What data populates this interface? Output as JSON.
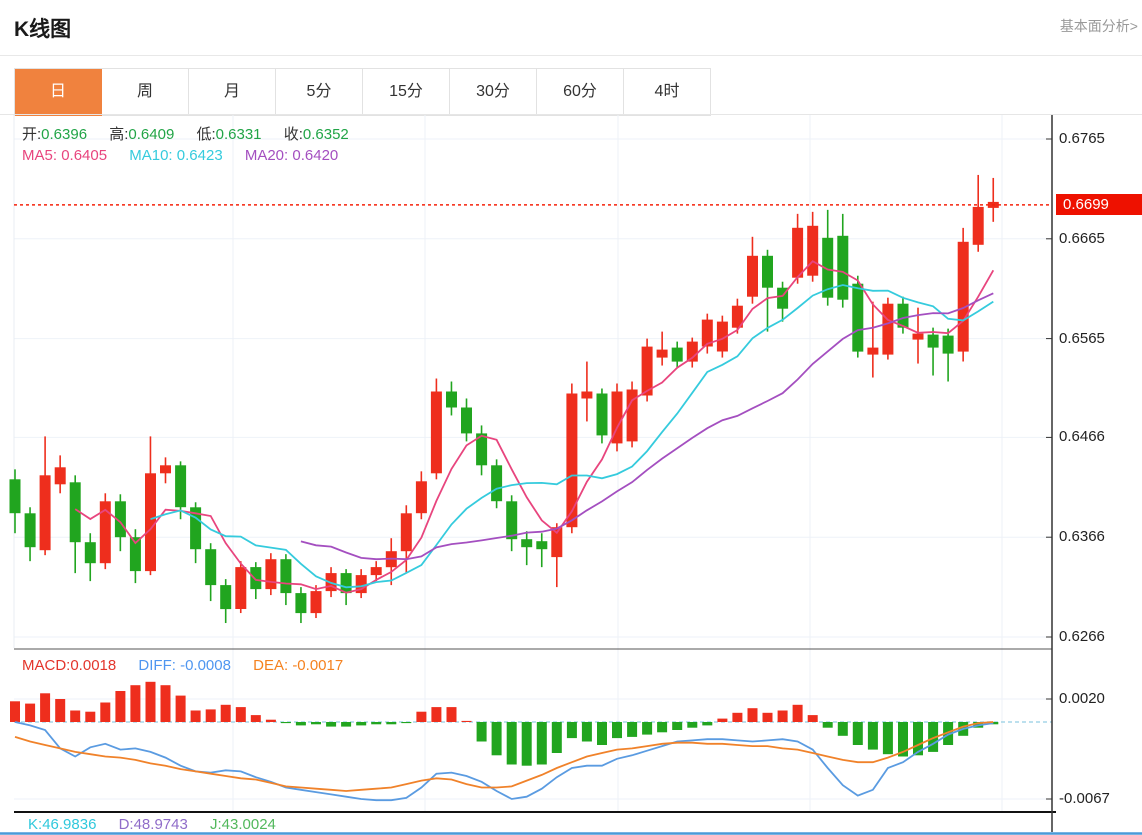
{
  "header": {
    "title": "K线图",
    "fundamental_link": "基本面分析>"
  },
  "tabs": {
    "items": [
      "日",
      "周",
      "月",
      "5分",
      "15分",
      "30分",
      "60分",
      "4时"
    ],
    "active_index": 0,
    "active_color": "#f0823e"
  },
  "legend_ohlc": {
    "value_color": "#21a447",
    "items": [
      {
        "label": "开:",
        "value": "0.6396"
      },
      {
        "label": "高:",
        "value": "0.6409"
      },
      {
        "label": "低:",
        "value": "0.6331"
      },
      {
        "label": "收:",
        "value": "0.6352"
      }
    ]
  },
  "legend_ma": {
    "items": [
      {
        "label": "MA5:",
        "value": "0.6405",
        "color": "#e8457e"
      },
      {
        "label": "MA10:",
        "value": "0.6423",
        "color": "#35cbdd"
      },
      {
        "label": "MA20:",
        "value": "0.6420",
        "color": "#a44fc0"
      }
    ]
  },
  "legend_macd": {
    "items": [
      {
        "label": "MACD:",
        "value": "0.0018",
        "color": "#e3352c"
      },
      {
        "label": "DIFF:",
        "value": "-0.0008",
        "color": "#4f96f0"
      },
      {
        "label": "DEA:",
        "value": "-0.0017",
        "color": "#f5821f"
      }
    ]
  },
  "legend_kdj": {
    "items": [
      {
        "label": "K:",
        "value": "46.9836",
        "color": "#2fc8dc"
      },
      {
        "label": "D:",
        "value": "48.9743",
        "color": "#8f6cc9"
      },
      {
        "label": "J:",
        "value": "43.0024",
        "color": "#52b85c"
      }
    ]
  },
  "price_marker": {
    "value": "0.6699",
    "price": 0.6699,
    "color": "#ee1100"
  },
  "chart_data": [
    {
      "type": "candlestick",
      "title": "K线图 (日)",
      "up_color": "#ee2e1d",
      "down_color": "#21a51f",
      "grid": true,
      "legend_position": "top-left",
      "y_axis_labels": [
        "0.6765",
        "0.6665",
        "0.6565",
        "0.6466",
        "0.6366",
        "0.6266"
      ],
      "current_price": 0.6699,
      "moving_averages": {
        "ma5": 0.6405,
        "ma10": 0.6423,
        "ma20": 0.642
      },
      "ohlc": [
        [
          0.6424,
          0.6434,
          0.637,
          0.639
        ],
        [
          0.639,
          0.6396,
          0.6342,
          0.6356
        ],
        [
          0.6353,
          0.6467,
          0.6348,
          0.6428
        ],
        [
          0.6419,
          0.6448,
          0.641,
          0.6436
        ],
        [
          0.6421,
          0.6428,
          0.633,
          0.6361
        ],
        [
          0.6361,
          0.637,
          0.6322,
          0.634
        ],
        [
          0.634,
          0.641,
          0.6334,
          0.6402
        ],
        [
          0.6402,
          0.6409,
          0.6352,
          0.6366
        ],
        [
          0.6366,
          0.6374,
          0.632,
          0.6332
        ],
        [
          0.6332,
          0.6467,
          0.6328,
          0.643
        ],
        [
          0.643,
          0.6446,
          0.642,
          0.6438
        ],
        [
          0.6438,
          0.6442,
          0.6384,
          0.6396
        ],
        [
          0.6396,
          0.6401,
          0.634,
          0.6354
        ],
        [
          0.6354,
          0.636,
          0.6302,
          0.6318
        ],
        [
          0.6318,
          0.6324,
          0.628,
          0.6294
        ],
        [
          0.6294,
          0.6342,
          0.629,
          0.6336
        ],
        [
          0.6336,
          0.6341,
          0.6304,
          0.6314
        ],
        [
          0.6314,
          0.635,
          0.6308,
          0.6344
        ],
        [
          0.6344,
          0.6349,
          0.6298,
          0.631
        ],
        [
          0.631,
          0.6316,
          0.628,
          0.629
        ],
        [
          0.629,
          0.6318,
          0.6285,
          0.6312
        ],
        [
          0.6312,
          0.6336,
          0.6306,
          0.633
        ],
        [
          0.633,
          0.6334,
          0.6298,
          0.631
        ],
        [
          0.631,
          0.6334,
          0.6305,
          0.6328
        ],
        [
          0.6328,
          0.6342,
          0.6322,
          0.6336
        ],
        [
          0.6336,
          0.6365,
          0.6318,
          0.6352
        ],
        [
          0.6352,
          0.6398,
          0.633,
          0.639
        ],
        [
          0.639,
          0.6432,
          0.6384,
          0.6422
        ],
        [
          0.643,
          0.6525,
          0.6424,
          0.6512
        ],
        [
          0.6512,
          0.6522,
          0.6488,
          0.6496
        ],
        [
          0.6496,
          0.6505,
          0.6462,
          0.647
        ],
        [
          0.647,
          0.6478,
          0.6428,
          0.6438
        ],
        [
          0.6438,
          0.6444,
          0.6395,
          0.6402
        ],
        [
          0.6402,
          0.6408,
          0.6352,
          0.6364
        ],
        [
          0.6364,
          0.6372,
          0.6338,
          0.6356
        ],
        [
          0.6362,
          0.637,
          0.6336,
          0.6354
        ],
        [
          0.6346,
          0.638,
          0.6316,
          0.6376
        ],
        [
          0.6376,
          0.652,
          0.637,
          0.651
        ],
        [
          0.6505,
          0.6542,
          0.6482,
          0.6512
        ],
        [
          0.651,
          0.6515,
          0.646,
          0.6468
        ],
        [
          0.646,
          0.652,
          0.6452,
          0.6512
        ],
        [
          0.6462,
          0.6522,
          0.6456,
          0.6514
        ],
        [
          0.6508,
          0.6565,
          0.6502,
          0.6557
        ],
        [
          0.6546,
          0.6572,
          0.6538,
          0.6554
        ],
        [
          0.6556,
          0.6562,
          0.6536,
          0.6542
        ],
        [
          0.6542,
          0.6566,
          0.6536,
          0.6562
        ],
        [
          0.6557,
          0.659,
          0.655,
          0.6584
        ],
        [
          0.6552,
          0.6588,
          0.6546,
          0.6582
        ],
        [
          0.6576,
          0.6605,
          0.657,
          0.6598
        ],
        [
          0.6607,
          0.6667,
          0.66,
          0.6648
        ],
        [
          0.6648,
          0.6654,
          0.6572,
          0.6616
        ],
        [
          0.6616,
          0.6622,
          0.6582,
          0.6595
        ],
        [
          0.6626,
          0.669,
          0.662,
          0.6676
        ],
        [
          0.6628,
          0.6692,
          0.6622,
          0.6678
        ],
        [
          0.6666,
          0.6694,
          0.6598,
          0.6606
        ],
        [
          0.6668,
          0.669,
          0.6596,
          0.6604
        ],
        [
          0.662,
          0.6628,
          0.6546,
          0.6552
        ],
        [
          0.6549,
          0.6602,
          0.6526,
          0.6556
        ],
        [
          0.6549,
          0.6606,
          0.6544,
          0.66
        ],
        [
          0.66,
          0.6607,
          0.657,
          0.6576
        ],
        [
          0.6564,
          0.6596,
          0.654,
          0.657
        ],
        [
          0.6569,
          0.6576,
          0.6528,
          0.6556
        ],
        [
          0.6568,
          0.6575,
          0.6522,
          0.655
        ],
        [
          0.6552,
          0.6676,
          0.6542,
          0.6662
        ],
        [
          0.6659,
          0.6729,
          0.6652,
          0.6697
        ],
        [
          0.6696,
          0.6726,
          0.6682,
          0.6702
        ]
      ]
    },
    {
      "type": "bar",
      "name": "MACD",
      "positive_color": "#ee2e1d",
      "negative_color": "#21a51f",
      "diff_color": "#5a9be1",
      "dea_color": "#f0822a",
      "y_axis_labels": [
        "0.0020",
        "-0.0067"
      ],
      "histogram": [
        0.0018,
        0.0016,
        0.0025,
        0.002,
        0.001,
        0.0009,
        0.0017,
        0.0027,
        0.0032,
        0.0035,
        0.0032,
        0.0023,
        0.001,
        0.0011,
        0.0015,
        0.0013,
        0.0006,
        0.0002,
        -0.0001,
        -0.0003,
        -0.0002,
        -0.0004,
        -0.0004,
        -0.0003,
        -0.0002,
        -0.0002,
        -0.0001,
        0.0009,
        0.0013,
        0.0013,
        0.0001,
        -0.0017,
        -0.0029,
        -0.0037,
        -0.0038,
        -0.0037,
        -0.0027,
        -0.0014,
        -0.0017,
        -0.002,
        -0.0014,
        -0.0013,
        -0.0011,
        -0.0009,
        -0.0007,
        -0.0005,
        -0.0003,
        0.0003,
        0.0008,
        0.0012,
        0.0008,
        0.001,
        0.0015,
        0.0006,
        -0.0005,
        -0.0012,
        -0.002,
        -0.0024,
        -0.0028,
        -0.003,
        -0.0029,
        -0.0026,
        -0.002,
        -0.0012,
        -0.0005,
        -0.0002
      ],
      "diff_line": [
        0.0,
        -0.0003,
        -0.0007,
        -0.0023,
        -0.003,
        -0.0022,
        -0.0019,
        -0.0024,
        -0.0023,
        -0.0026,
        -0.0031,
        -0.0038,
        -0.0043,
        -0.0044,
        -0.0042,
        -0.0043,
        -0.0048,
        -0.0052,
        -0.0057,
        -0.0059,
        -0.0061,
        -0.0063,
        -0.0065,
        -0.0067,
        -0.0068,
        -0.0068,
        -0.0066,
        -0.0057,
        -0.0045,
        -0.0044,
        -0.0047,
        -0.0052,
        -0.006,
        -0.0067,
        -0.0065,
        -0.0058,
        -0.0048,
        -0.004,
        -0.0038,
        -0.0038,
        -0.0032,
        -0.0029,
        -0.0025,
        -0.0021,
        -0.0017,
        -0.0016,
        -0.0015,
        -0.0015,
        -0.0016,
        -0.0017,
        -0.0016,
        -0.0015,
        -0.0017,
        -0.0024,
        -0.004,
        -0.0055,
        -0.0064,
        -0.0059,
        -0.004,
        -0.0035,
        -0.0026,
        -0.0019,
        -0.0011,
        -0.0006,
        -0.0003,
        -0.0001
      ],
      "dea_line": [
        -0.0013,
        -0.0017,
        -0.002,
        -0.0023,
        -0.0026,
        -0.0028,
        -0.003,
        -0.0031,
        -0.0033,
        -0.0036,
        -0.0038,
        -0.0041,
        -0.0043,
        -0.0045,
        -0.0047,
        -0.0049,
        -0.005,
        -0.0053,
        -0.0056,
        -0.0057,
        -0.0058,
        -0.0059,
        -0.006,
        -0.0059,
        -0.0058,
        -0.0057,
        -0.0054,
        -0.0051,
        -0.0049,
        -0.005,
        -0.0054,
        -0.0057,
        -0.0057,
        -0.0056,
        -0.0051,
        -0.0046,
        -0.004,
        -0.0035,
        -0.003,
        -0.0027,
        -0.0024,
        -0.0023,
        -0.0021,
        -0.0019,
        -0.0018,
        -0.0018,
        -0.0019,
        -0.0019,
        -0.002,
        -0.0021,
        -0.0021,
        -0.0023,
        -0.0024,
        -0.0027,
        -0.003,
        -0.0033,
        -0.0035,
        -0.0035,
        -0.0031,
        -0.0026,
        -0.002,
        -0.0014,
        -0.0009,
        -0.0004,
        -0.0001,
        0.0
      ]
    }
  ]
}
